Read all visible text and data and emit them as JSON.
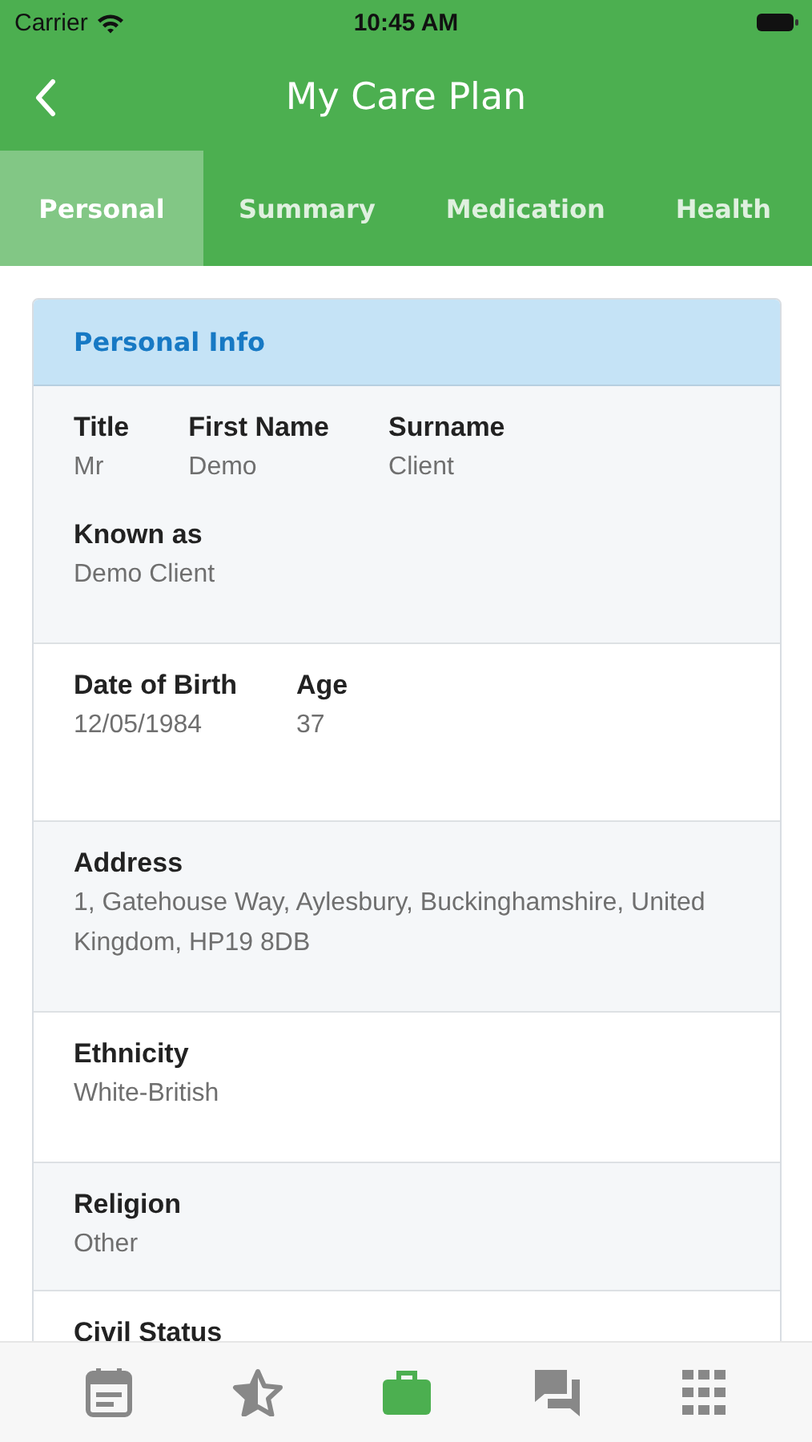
{
  "status_bar": {
    "carrier": "Carrier",
    "time": "10:45 AM"
  },
  "header": {
    "title": "My Care Plan"
  },
  "tabs": [
    {
      "label": "Personal",
      "selected": true
    },
    {
      "label": "Summary",
      "selected": false
    },
    {
      "label": "Medication",
      "selected": false
    },
    {
      "label": "Health",
      "selected": false
    }
  ],
  "card": {
    "title": "Personal Info",
    "sections": [
      {
        "rows": [
          [
            {
              "label": "Title",
              "value": "Mr"
            },
            {
              "label": "First Name",
              "value": "Demo"
            },
            {
              "label": "Surname",
              "value": "Client"
            }
          ],
          [
            {
              "label": "Known as",
              "value": "Demo Client"
            }
          ]
        ]
      },
      {
        "rows": [
          [
            {
              "label": "Date of Birth",
              "value": "12/05/1984"
            },
            {
              "label": "Age",
              "value": "37"
            }
          ]
        ]
      },
      {
        "rows": [
          [
            {
              "label": "Address",
              "value": "1, Gatehouse Way, Aylesbury, Buckinghamshire, United Kingdom, HP19 8DB"
            }
          ]
        ]
      },
      {
        "rows": [
          [
            {
              "label": "Ethnicity",
              "value": "White-British"
            }
          ]
        ]
      },
      {
        "rows": [
          [
            {
              "label": "Religion",
              "value": "Other"
            }
          ]
        ]
      },
      {
        "rows": [
          [
            {
              "label": "Civil Status"
            }
          ]
        ]
      }
    ]
  },
  "bottom_nav": [
    {
      "kind": "calendar",
      "selected": false
    },
    {
      "kind": "star",
      "selected": false
    },
    {
      "kind": "briefcase",
      "selected": true
    },
    {
      "kind": "chat",
      "selected": false
    },
    {
      "kind": "grid",
      "selected": false
    }
  ]
}
